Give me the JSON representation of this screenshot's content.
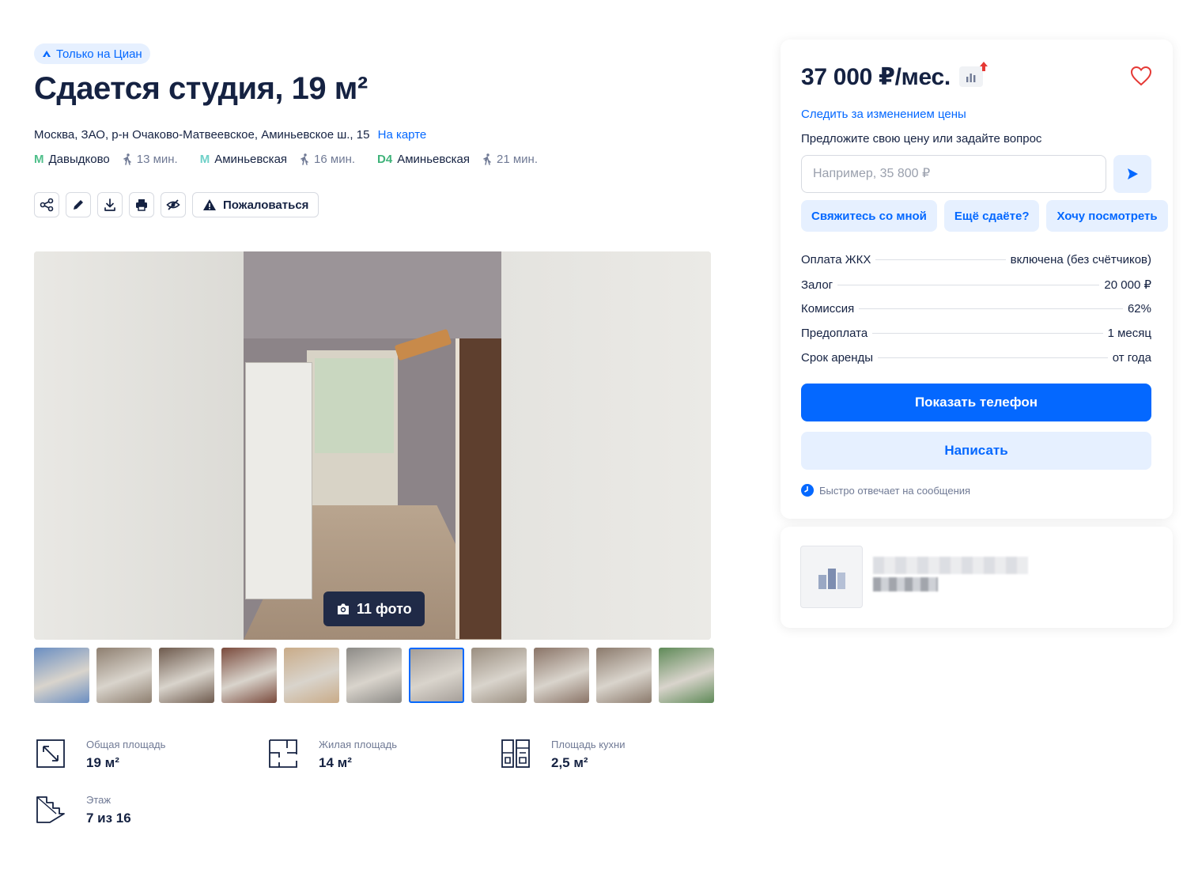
{
  "badge": "Только на Циан",
  "title": "Сдается студия, 19 м²",
  "address": {
    "text": "Москва, ЗАО, р-н Очаково-Матвеевское, Аминьевское ш., 15",
    "map_link": "На карте"
  },
  "metro": [
    {
      "line": "М",
      "line_color": "#4fbf8a",
      "name": "Давыдково",
      "time": "13 мин."
    },
    {
      "line": "М",
      "line_color": "#6fd1c8",
      "name": "Аминьевская",
      "time": "16 мин."
    },
    {
      "line": "D4",
      "line_color": "#40b37a",
      "name": "Аминьевская",
      "time": "21 мин."
    }
  ],
  "toolbar": {
    "report_label": "Пожаловаться"
  },
  "gallery": {
    "photo_count": "11 фото",
    "thumbs": [
      {
        "icon": "building-exterior",
        "color": "#6a8ec2"
      },
      {
        "icon": "corridor",
        "color": "#8e7f70"
      },
      {
        "icon": "hallway-door",
        "color": "#6e5a4d"
      },
      {
        "icon": "bathroom-door",
        "color": "#7a4a3c"
      },
      {
        "icon": "bathroom",
        "color": "#c9ab88"
      },
      {
        "icon": "kitchen",
        "color": "#8c8a86"
      },
      {
        "icon": "hallway-view",
        "color": "#a39c96"
      },
      {
        "icon": "room",
        "color": "#9a8e80"
      },
      {
        "icon": "room-bed",
        "color": "#8a7467"
      },
      {
        "icon": "room-window",
        "color": "#8b7a6c"
      },
      {
        "icon": "window-view",
        "color": "#5f8a58"
      }
    ],
    "active_thumb": 6
  },
  "params": [
    {
      "icon": "area-icon",
      "label": "Общая площадь",
      "value": "19 м²"
    },
    {
      "icon": "living-area-icon",
      "label": "Жилая площадь",
      "value": "14 м²"
    },
    {
      "icon": "kitchen-icon",
      "label": "Площадь кухни",
      "value": "2,5 м²"
    },
    {
      "icon": "floor-icon",
      "label": "Этаж",
      "value": "7 из 16"
    }
  ],
  "card": {
    "price": "37 000 ₽/мес.",
    "watch_price": "Следить за изменением цены",
    "offer_label": "Предложите свою цену или задайте вопрос",
    "offer_placeholder": "Например, 35 800 ₽",
    "chips": [
      "Свяжитесь со мной",
      "Ещё сдаёте?",
      "Хочу посмотреть"
    ],
    "terms": [
      {
        "label": "Оплата ЖКХ",
        "value": "включена (без счётчиков)"
      },
      {
        "label": "Залог",
        "value": "20 000 ₽"
      },
      {
        "label": "Комиссия",
        "value": "62%"
      },
      {
        "label": "Предоплата",
        "value": "1 месяц"
      },
      {
        "label": "Срок аренды",
        "value": "от года"
      }
    ],
    "show_phone": "Показать телефон",
    "write": "Написать",
    "fast_reply": "Быстро отвечает на сообщения"
  },
  "colors": {
    "accent": "#0468ff",
    "text": "#152242",
    "muted": "#707a95",
    "light_accent": "#e6f0ff",
    "favorite": "#e53935"
  }
}
